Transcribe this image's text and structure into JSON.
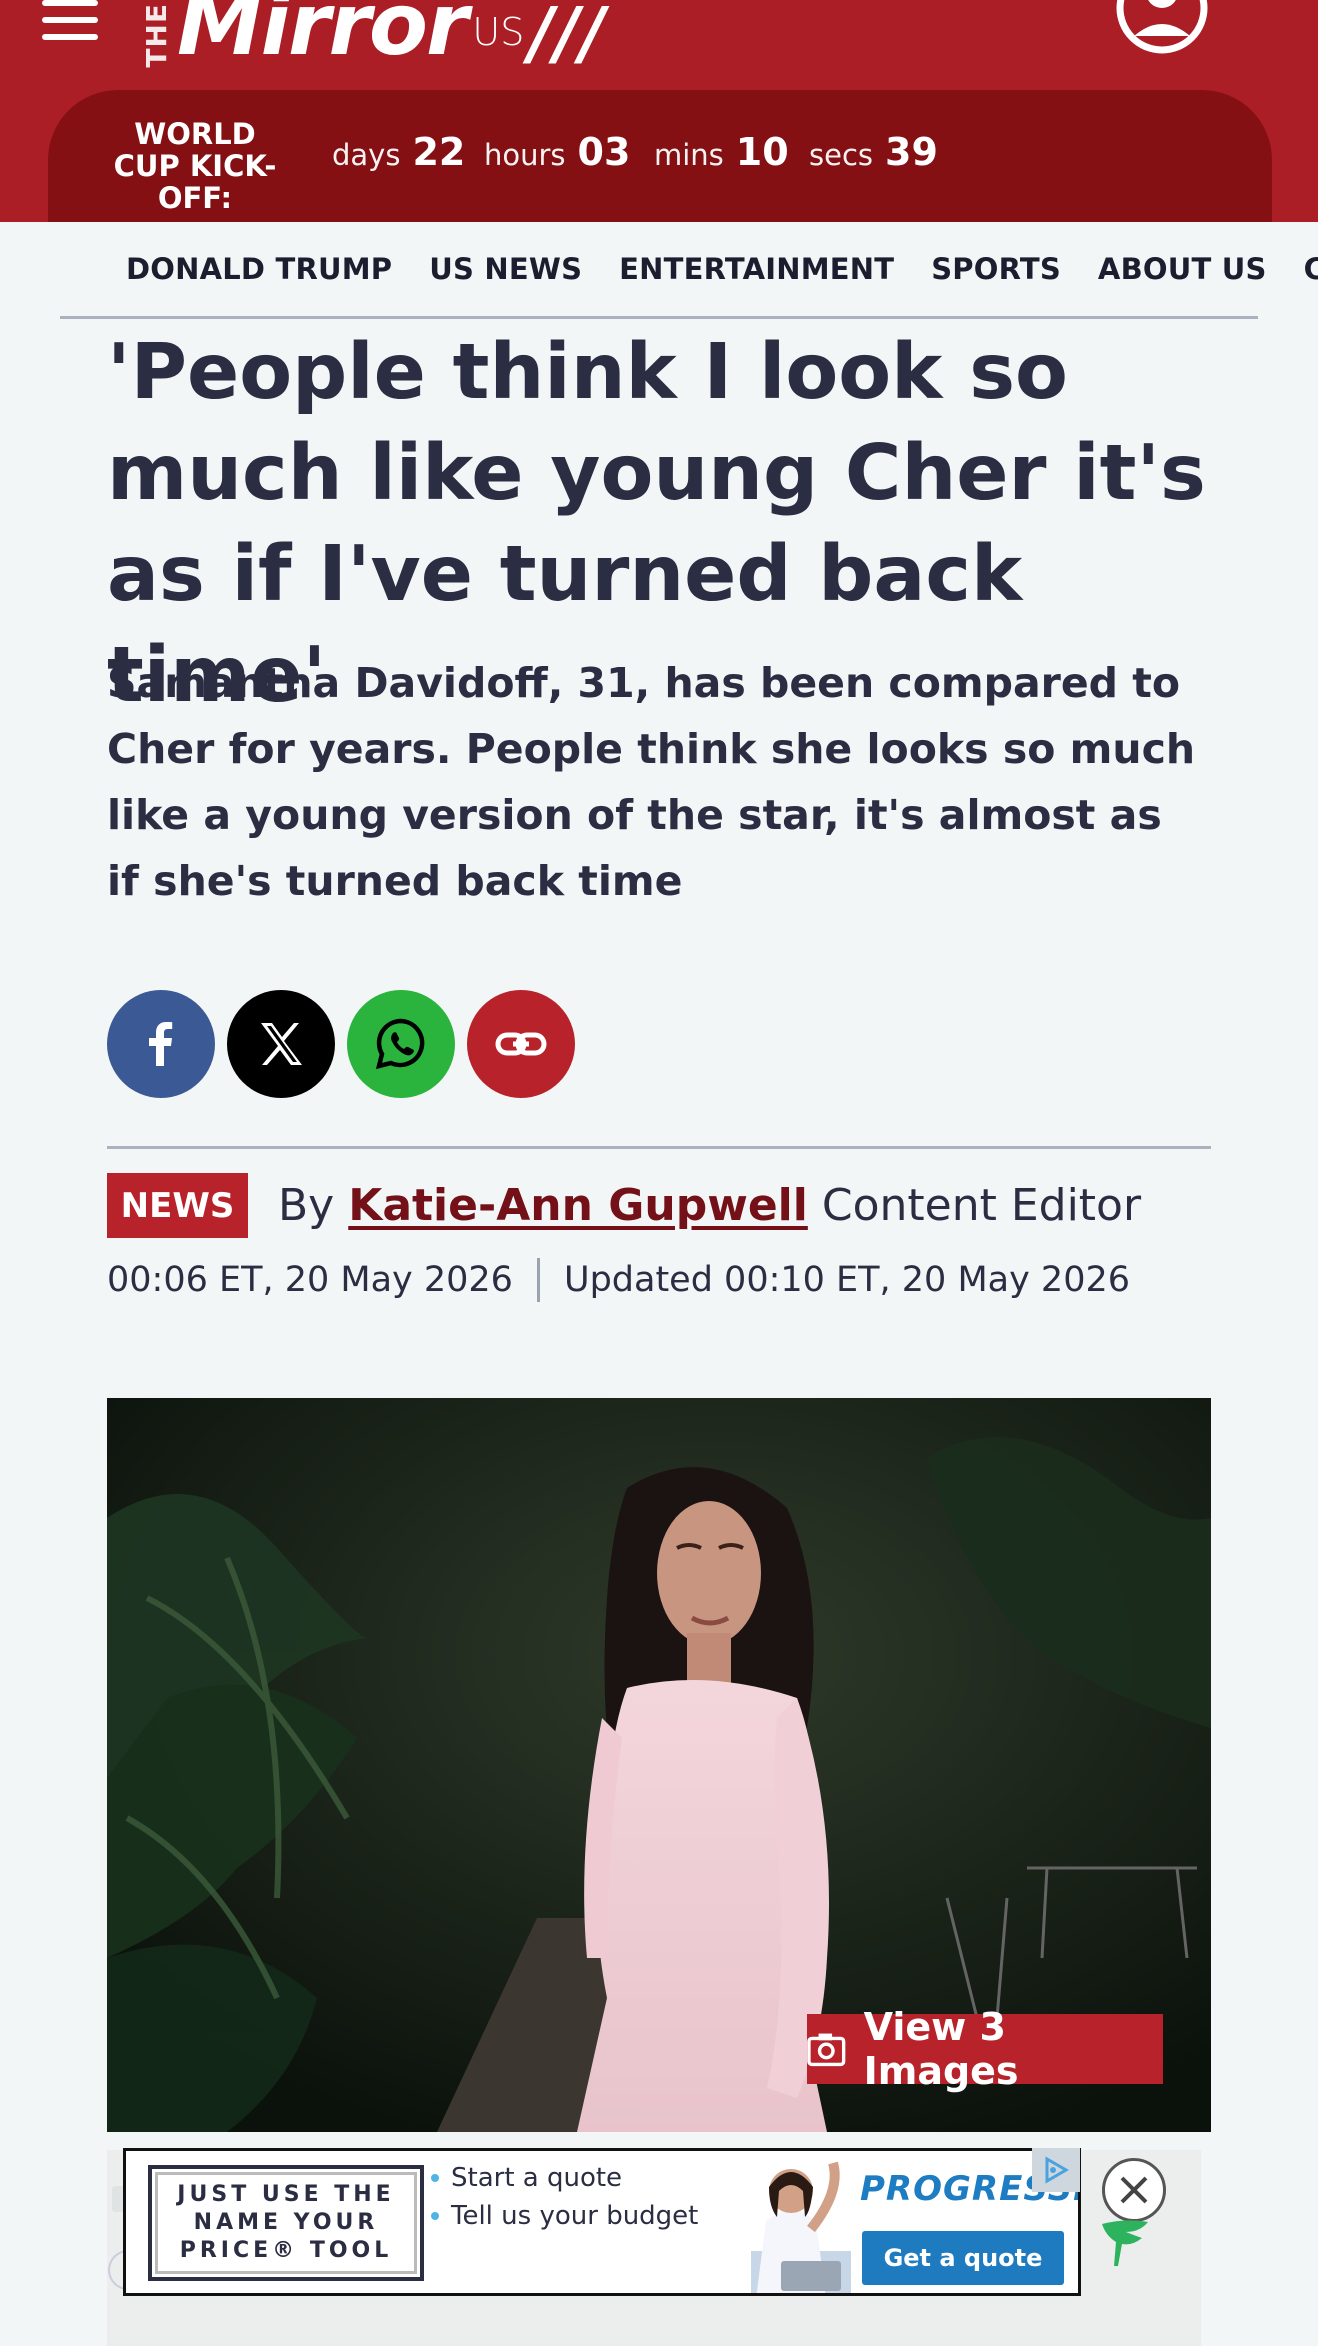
{
  "header": {
    "logo_the": "THE",
    "logo_mirror": "Mirror",
    "logo_us": "US",
    "logo_slashes": "///",
    "countdown": {
      "label": "WORLD CUP KICK-OFF:",
      "days_label": "days",
      "days": "22",
      "hours_label": "hours",
      "hours": "03",
      "mins_label": "mins",
      "mins": "10",
      "secs_label": "secs",
      "secs": "39"
    }
  },
  "nav": {
    "items": [
      "DONALD TRUMP",
      "US NEWS",
      "ENTERTAINMENT",
      "SPORTS",
      "ABOUT US",
      "COI"
    ]
  },
  "article": {
    "headline": "'People think I look so much like young Cher it's as if I've turned back time'",
    "standfirst": "Samantha Davidoff, 31, has been compared to Cher for years. People think she looks so much like a young version of the star, it's almost as if she's turned back time",
    "badge": "NEWS",
    "by": "By",
    "author": "Katie-Ann Gupwell",
    "role": "Content Editor",
    "published": "00:06 ET, 20 May 2026",
    "updated": "Updated 00:10 ET, 20 May 2026",
    "view_images": "View 3 Images"
  },
  "share": {
    "facebook_icon": "facebook-icon",
    "x_icon": "x-icon",
    "whatsapp_icon": "whatsapp-icon",
    "link_icon": "link-icon"
  },
  "ad": {
    "tool_text": "JUST USE THE NAME YOUR PRICE® TOOL",
    "bullet_1": "Start a quote",
    "bullet_2": "Tell us your budget",
    "brand": "PROGRESSIVE",
    "cta": "Get a quote"
  },
  "colors": {
    "brand_red": "#ab1e25",
    "countdown_red": "#841014",
    "text_navy": "#2b2d42",
    "facebook": "#3b5a95",
    "whatsapp": "#2ab43d"
  }
}
